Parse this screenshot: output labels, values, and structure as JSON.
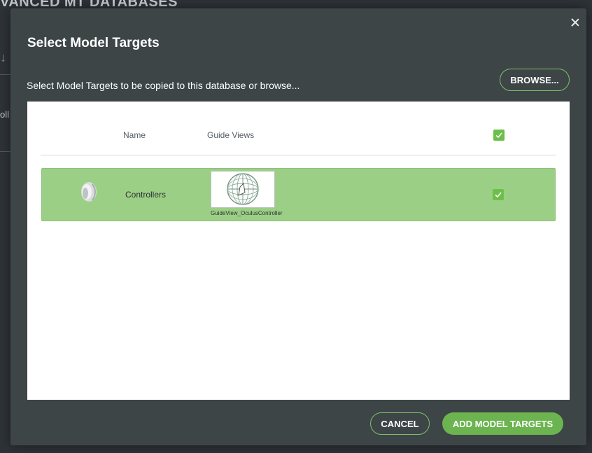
{
  "background": {
    "title": "VANCED MT DATABASES",
    "row_text": "oll"
  },
  "modal": {
    "title": "Select Model Targets",
    "subtitle": "Select Model Targets to be copied to this database or browse...",
    "browse_label": "BROWSE...",
    "table": {
      "columns": {
        "name": "Name",
        "guide_views": "Guide Views"
      },
      "select_all_checked": true,
      "rows": [
        {
          "name": "Controllers",
          "guide_view_caption": "GuideView_OculusController",
          "selected": true
        }
      ]
    },
    "cancel_label": "CANCEL",
    "add_label": "ADD MODEL TARGETS"
  },
  "colors": {
    "accent": "#6cb450",
    "row_selected": "#9ccf86",
    "modal_bg": "#3d4547"
  },
  "icons": {
    "close": "close-icon",
    "arrow": "arrow-down-icon",
    "check": "check-icon"
  }
}
